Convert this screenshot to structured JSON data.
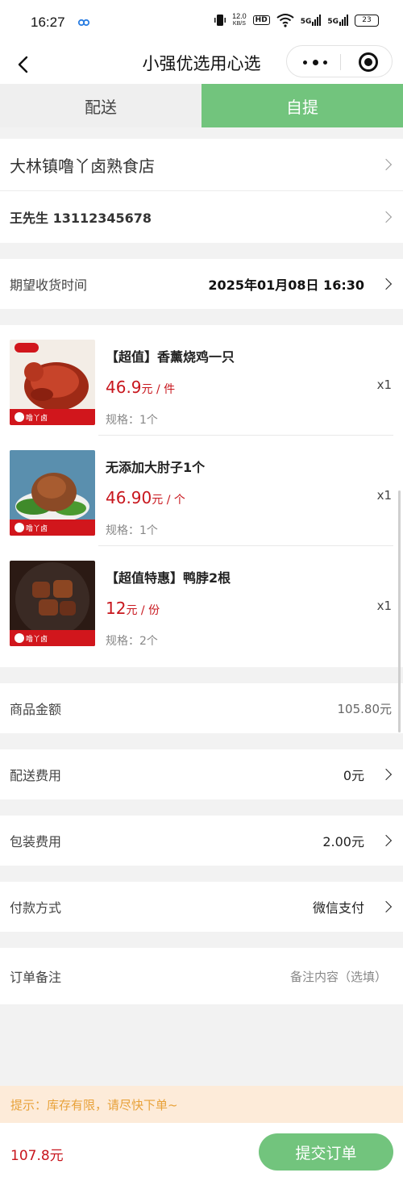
{
  "status_bar": {
    "time": "16:27",
    "speed_value": "12.0",
    "speed_unit": "KB/S",
    "hd": "HD",
    "sig1": "5G",
    "sig2": "5G",
    "battery": "23"
  },
  "nav": {
    "title": "小强优选用心选"
  },
  "tabs": [
    {
      "label": "配送",
      "active": false
    },
    {
      "label": "自提",
      "active": true
    }
  ],
  "pickup": {
    "store_name": "大林镇噜丫卤熟食店",
    "contact": "王先生 13112345678",
    "time_label": "期望收货时间",
    "time_value": "2025年01月08日 16:30"
  },
  "products": [
    {
      "name": "【超值】香薰烧鸡一只",
      "price": "46.9",
      "unit": "元 / 件",
      "spec": "规格：1个",
      "qty": "x1",
      "thumb": "roast-chicken"
    },
    {
      "name": "无添加大肘子1个",
      "price": "46.90",
      "unit": "元 / 个",
      "spec": "规格：1个",
      "qty": "x1",
      "thumb": "pork-knuckle"
    },
    {
      "name": "【超值特惠】鸭脖2根",
      "price": "12",
      "unit": "元 / 份",
      "spec": "规格：2个",
      "qty": "x1",
      "thumb": "duck-neck"
    }
  ],
  "summary": {
    "goods_label": "商品金额",
    "goods_value": "105.80元",
    "delivery_label": "配送费用",
    "delivery_value": "0元",
    "package_label": "包装费用",
    "package_value": "2.00元",
    "payment_label": "付款方式",
    "payment_value": "微信支付",
    "remark_label": "订单备注",
    "remark_placeholder": "备注内容（选填）"
  },
  "tip": "提示：库存有限，请尽快下单~",
  "footer": {
    "total": "107.8元",
    "submit": "提交订单"
  },
  "thumb_brand": "噜丫卤",
  "colors": {
    "accent": "#72c47d",
    "price": "#c8161d",
    "tip_bg": "#fdebd9",
    "tip_text": "#e8a23a"
  }
}
